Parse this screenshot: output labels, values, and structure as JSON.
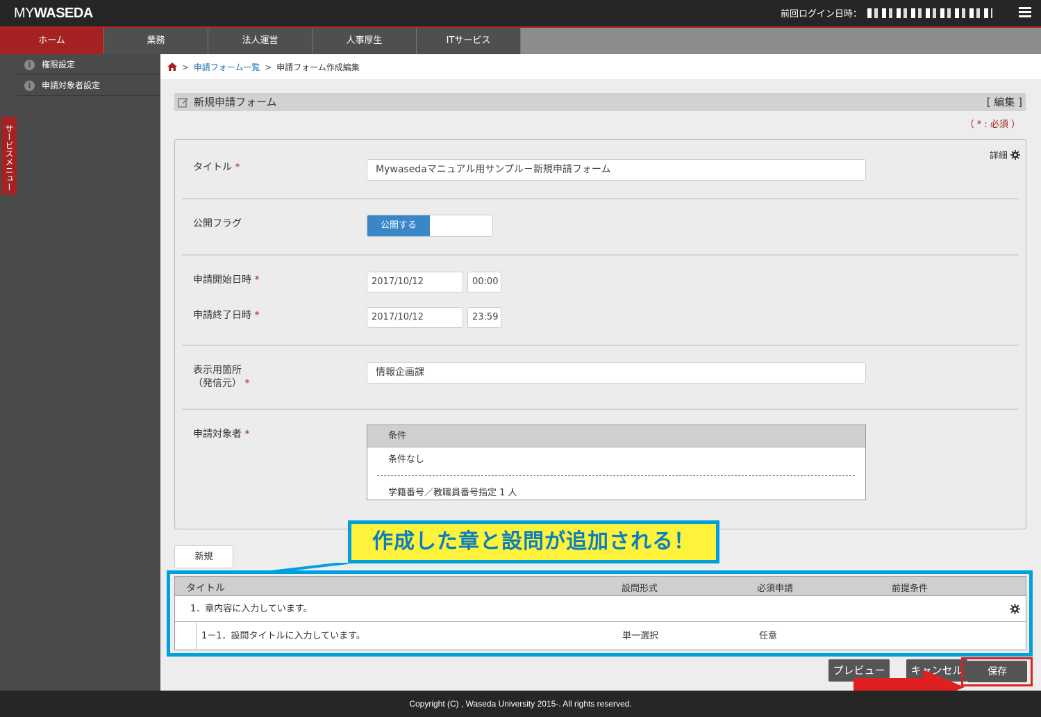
{
  "header": {
    "logo_my": "MY",
    "logo_waseda": "WASEDA",
    "last_login_label": "前回ログイン日時："
  },
  "nav": {
    "tabs": [
      {
        "label": "ホーム",
        "active": true
      },
      {
        "label": "業務"
      },
      {
        "label": "法人運営"
      },
      {
        "label": "人事厚生"
      },
      {
        "label": "ITサービス"
      }
    ]
  },
  "sidebar": {
    "items": [
      {
        "label": "権限設定"
      },
      {
        "label": "申請対象者設定"
      }
    ],
    "service_menu": "サービスメニュー"
  },
  "breadcrumb": {
    "link": "申請フォーム一覧",
    "separator": ">",
    "current": "申請フォーム作成編集"
  },
  "section": {
    "title": "新規申請フォーム",
    "edit": "[ 編集 ]",
    "required_note": "（ * : 必須 ）",
    "detail": "詳細"
  },
  "form": {
    "title_label": "タイトル",
    "title_value": "Mywasedaマニュアル用サンプル－新規申請フォーム",
    "publish_label": "公開フラグ",
    "publish_toggle": "公開する",
    "start_label": "申請開始日時",
    "start_date": "2017/10/12",
    "start_time": "00:00",
    "end_label": "申請終了日時",
    "end_date": "2017/10/12",
    "end_time": "23:59",
    "display_label_1": "表示用箇所",
    "display_label_2": "（発信元）",
    "display_value": "情報企画課",
    "target_label": "申請対象者",
    "star": "*",
    "condition_header": "条件",
    "condition_row1": "条件なし",
    "condition_row2": "学籍番号／教職員番号指定 1 人"
  },
  "new_button": "新規",
  "callout": "作成した章と設問が追加される！",
  "table": {
    "headers": [
      "タイトル",
      "設問形式",
      "必須申請",
      "前提条件"
    ],
    "chapter": "1．章内容に入力しています。",
    "question": {
      "title": "1－1．設問タイトルに入力しています。",
      "format": "単一選択",
      "required": "任意"
    }
  },
  "buttons": {
    "preview": "プレビュー",
    "cancel": "キャンセル",
    "save": "保存"
  },
  "footer": "Copyright (C) , Waseda University 2015-. All rights reserved.",
  "colors": {
    "brand_red": "#a52222",
    "toggle_blue": "#3a87c8",
    "callout_blue": "#00a0e0",
    "callout_yellow": "#fff23a",
    "highlight_red": "#e02020"
  },
  "icons": [
    "home-icon",
    "info-icon",
    "edit-icon",
    "gear-icon",
    "menu-icon",
    "arrow-icon"
  ]
}
